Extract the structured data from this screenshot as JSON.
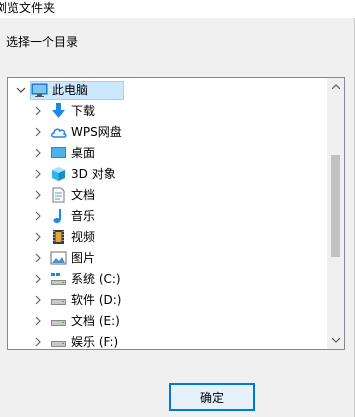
{
  "window": {
    "title": "浏览文件夹"
  },
  "instruction": "选择一个目录",
  "tree": {
    "root": {
      "label": "此电脑",
      "icon": "computer-icon",
      "expanded": true
    },
    "items": [
      {
        "label": "下载",
        "icon": "download-arrow-icon"
      },
      {
        "label": "WPS网盘",
        "icon": "cloud-icon"
      },
      {
        "label": "桌面",
        "icon": "desktop-icon"
      },
      {
        "label": "3D 对象",
        "icon": "3d-cube-icon"
      },
      {
        "label": "文档",
        "icon": "document-icon"
      },
      {
        "label": "音乐",
        "icon": "music-note-icon"
      },
      {
        "label": "视频",
        "icon": "film-icon"
      },
      {
        "label": "图片",
        "icon": "picture-icon"
      },
      {
        "label": "系统 (C:)",
        "icon": "drive-icon"
      },
      {
        "label": "软件 (D:)",
        "icon": "drive-icon"
      },
      {
        "label": "文档 (E:)",
        "icon": "drive-icon"
      },
      {
        "label": "娱乐 (F:)",
        "icon": "drive-icon"
      }
    ]
  },
  "buttons": {
    "ok": "确定"
  },
  "colors": {
    "selection": "#cce8ff",
    "accent": "#0078d7"
  }
}
